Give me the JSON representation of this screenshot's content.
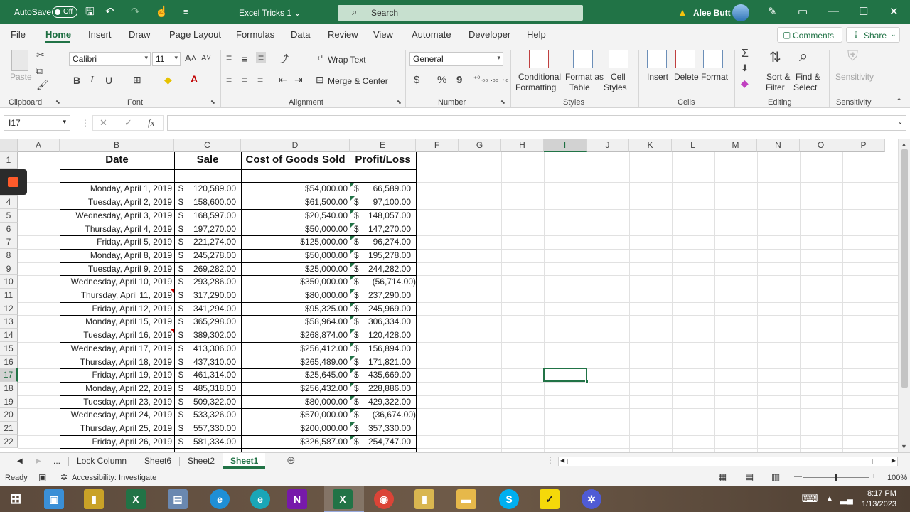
{
  "titlebar": {
    "autosave_label": "AutoSave",
    "autosave_state": "Off",
    "doc_title": "Excel Tricks 1",
    "search_placeholder": "Search",
    "user_name": "Alee Butt"
  },
  "tabs": [
    "File",
    "Home",
    "Insert",
    "Draw",
    "Page Layout",
    "Formulas",
    "Data",
    "Review",
    "View",
    "Automate",
    "Developer",
    "Help"
  ],
  "active_tab": "Home",
  "comments_label": "Comments",
  "share_label": "Share",
  "ribbon": {
    "clipboard": {
      "paste": "Paste",
      "group": "Clipboard"
    },
    "font": {
      "name": "Calibri",
      "size": "11",
      "bold": "B",
      "italic": "I",
      "underline": "U",
      "group": "Font"
    },
    "alignment": {
      "wrap": "Wrap Text",
      "merge": "Merge & Center",
      "group": "Alignment"
    },
    "number": {
      "format": "General",
      "currency": "$",
      "percent": "%",
      "comma": "9",
      "group": "Number"
    },
    "styles": {
      "cond_1": "Conditional",
      "cond_2": "Formatting",
      "fmt_1": "Format as",
      "fmt_2": "Table",
      "cell_1": "Cell",
      "cell_2": "Styles",
      "group": "Styles"
    },
    "cells": {
      "insert": "Insert",
      "delete": "Delete",
      "format": "Format",
      "group": "Cells"
    },
    "editing": {
      "sort_1": "Sort &",
      "sort_2": "Filter",
      "find_1": "Find &",
      "find_2": "Select",
      "group": "Editing"
    },
    "sensitivity": {
      "label": "Sensitivity",
      "group": "Sensitivity"
    }
  },
  "formula_bar": {
    "name_box": "I17",
    "cancel": "✕",
    "enter": "✓",
    "fx": "fx",
    "value": ""
  },
  "columns": [
    "A",
    "B",
    "C",
    "D",
    "E",
    "F",
    "G",
    "H",
    "I",
    "J",
    "K",
    "L",
    "M",
    "N",
    "O",
    "P"
  ],
  "selected_column": "I",
  "selected_row": "17",
  "rows": [
    "1",
    "",
    "",
    "4",
    "5",
    "6",
    "7",
    "8",
    "9",
    "10",
    "11",
    "12",
    "13",
    "14",
    "15",
    "16",
    "17",
    "18",
    "19",
    "20",
    "21",
    "22"
  ],
  "table": {
    "headers": [
      "Date",
      "Sale",
      "Cost of Goods Sold",
      "Profit/Loss"
    ],
    "currency_symbol": "$",
    "records": [
      {
        "date": "Monday, April 1, 2019",
        "sale": "120,589.00",
        "cogs": "$54,000.00",
        "profit": "66,589.00"
      },
      {
        "date": "Tuesday, April 2, 2019",
        "sale": "158,600.00",
        "cogs": "$61,500.00",
        "profit": "97,100.00"
      },
      {
        "date": "Wednesday, April 3, 2019",
        "sale": "168,597.00",
        "cogs": "$20,540.00",
        "profit": "148,057.00"
      },
      {
        "date": "Thursday, April 4, 2019",
        "sale": "197,270.00",
        "cogs": "$50,000.00",
        "profit": "147,270.00"
      },
      {
        "date": "Friday, April 5, 2019",
        "sale": "221,274.00",
        "cogs": "$125,000.00",
        "profit": "96,274.00"
      },
      {
        "date": "Monday, April 8, 2019",
        "sale": "245,278.00",
        "cogs": "$50,000.00",
        "profit": "195,278.00"
      },
      {
        "date": "Tuesday, April 9, 2019",
        "sale": "269,282.00",
        "cogs": "$25,000.00",
        "profit": "244,282.00"
      },
      {
        "date": "Wednesday, April 10, 2019",
        "sale": "293,286.00",
        "cogs": "$350,000.00",
        "profit": "(56,714.00)"
      },
      {
        "date": "Thursday, April 11, 2019",
        "sale": "317,290.00",
        "cogs": "$80,000.00",
        "profit": "237,290.00"
      },
      {
        "date": "Friday, April 12, 2019",
        "sale": "341,294.00",
        "cogs": "$95,325.00",
        "profit": "245,969.00"
      },
      {
        "date": "Monday, April 15, 2019",
        "sale": "365,298.00",
        "cogs": "$58,964.00",
        "profit": "306,334.00"
      },
      {
        "date": "Tuesday, April 16, 2019",
        "sale": "389,302.00",
        "cogs": "$268,874.00",
        "profit": "120,428.00"
      },
      {
        "date": "Wednesday, April 17, 2019",
        "sale": "413,306.00",
        "cogs": "$256,412.00",
        "profit": "156,894.00"
      },
      {
        "date": "Thursday, April 18, 2019",
        "sale": "437,310.00",
        "cogs": "$265,489.00",
        "profit": "171,821.00"
      },
      {
        "date": "Friday, April 19, 2019",
        "sale": "461,314.00",
        "cogs": "$25,645.00",
        "profit": "435,669.00"
      },
      {
        "date": "Monday, April 22, 2019",
        "sale": "485,318.00",
        "cogs": "$256,432.00",
        "profit": "228,886.00"
      },
      {
        "date": "Tuesday, April 23, 2019",
        "sale": "509,322.00",
        "cogs": "$80,000.00",
        "profit": "429,322.00"
      },
      {
        "date": "Wednesday, April 24, 2019",
        "sale": "533,326.00",
        "cogs": "$570,000.00",
        "profit": "(36,674.00)"
      },
      {
        "date": "Thursday, April 25, 2019",
        "sale": "557,330.00",
        "cogs": "$200,000.00",
        "profit": "357,330.00"
      },
      {
        "date": "Friday, April 26, 2019",
        "sale": "581,334.00",
        "cogs": "$326,587.00",
        "profit": "254,747.00"
      }
    ]
  },
  "sheet_tabs": [
    "...",
    "Lock Column",
    "Sheet6",
    "Sheet2",
    "Sheet1"
  ],
  "active_sheet": "Sheet1",
  "statusbar": {
    "ready": "Ready",
    "accessibility": "Accessibility: Investigate",
    "zoom": "100%"
  },
  "taskbar": {
    "time": "8:17 PM",
    "date": "1/13/2023"
  },
  "colors": {
    "excel_green": "#217346",
    "title_bar": "#217346",
    "ribbon_bg": "#f3f3f3"
  }
}
